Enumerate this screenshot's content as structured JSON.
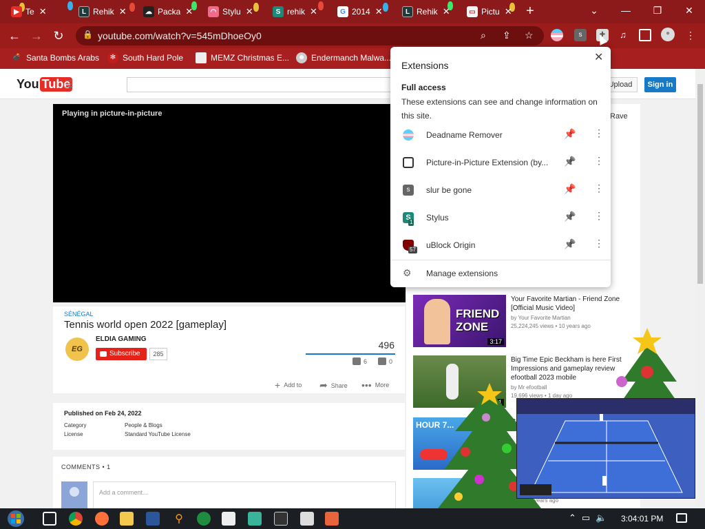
{
  "tabs": [
    {
      "title": "Te",
      "icon": "youtube-icon"
    },
    {
      "title": "Rehik",
      "icon": "letter-l-icon"
    },
    {
      "title": "Packa",
      "icon": "cloud-icon"
    },
    {
      "title": "Stylu",
      "icon": "rainbow-icon"
    },
    {
      "title": "rehik",
      "icon": "stylus-s-icon"
    },
    {
      "title": "2014",
      "icon": "google-icon"
    },
    {
      "title": "Rehik",
      "icon": "letter-l-icon"
    },
    {
      "title": "Pictu",
      "icon": "picture-icon"
    }
  ],
  "address": {
    "url": "youtube.com/watch?v=545mDhoeOy0"
  },
  "bookmarks": [
    {
      "label": "Santa Bombs Arabs"
    },
    {
      "label": "South Hard Pole"
    },
    {
      "label": "MEMZ Christmas E..."
    },
    {
      "label": "Endermanch Malwa..."
    }
  ],
  "youtube": {
    "logo_you": "You",
    "logo_tube": "Tube",
    "upload": "Upload",
    "sign_in": "Sign in",
    "pip_text": "Playing in picture-in-picture",
    "category": "SÉNÉGAL",
    "title": "Tennis world open 2022 [gameplay]",
    "channel": "ELDIA GAMING",
    "avatar_text": "EG",
    "subscribe": "Subscribe",
    "sub_count": "285",
    "views": "496",
    "likes": "6",
    "dislikes": "0",
    "add_to": "Add to",
    "share": "Share",
    "more": "More",
    "published": "Published on Feb 24, 2022",
    "category_label": "Category",
    "category_value": "People & Blogs",
    "license_label": "License",
    "license_value": "Standard YouTube License",
    "comments": "COMMENTS • 1",
    "comment_placeholder": "Add a comment..."
  },
  "sidebar": {
    "top_label": "Rave",
    "related": [
      {
        "title": "Your Favorite Martian - Friend Zone [Official Music Video]",
        "by": "by Your Favorite Martian",
        "stats": "25,224,245 views • 10 years ago",
        "duration": "3:17",
        "thumb_text": "FRIEND ZONE"
      },
      {
        "title": "Big Time Epic Beckham is here First Impressions and gameplay review efootball 2023 mobile",
        "by": "by Mr efootball",
        "stats": "19,696 views • 1 day ago",
        "duration": "5:41"
      },
      {
        "title": "C",
        "stats": "",
        "thumb_text": "HOUR 7..."
      },
      {
        "stats": "views • 5 years ago"
      }
    ]
  },
  "extensions_popup": {
    "title": "Extensions",
    "section": "Full access",
    "description": "These extensions can see and change information on this site.",
    "items": [
      {
        "name": "Deadname Remover",
        "pinned": true
      },
      {
        "name": "Picture-in-Picture Extension (by...",
        "pinned": false
      },
      {
        "name": "slur be gone",
        "pinned": true
      },
      {
        "name": "Stylus",
        "pinned": false,
        "badge": "1"
      },
      {
        "name": "uBlock Origin",
        "pinned": false,
        "badge": "57"
      }
    ],
    "manage": "Manage extensions"
  },
  "taskbar": {
    "clock": "3:04:01 PM"
  },
  "colors": {
    "chrome": "#9c1b1b",
    "youtube_red": "#e52d27",
    "accent_blue": "#167ac6",
    "pin_blue": "#1a73e8"
  }
}
